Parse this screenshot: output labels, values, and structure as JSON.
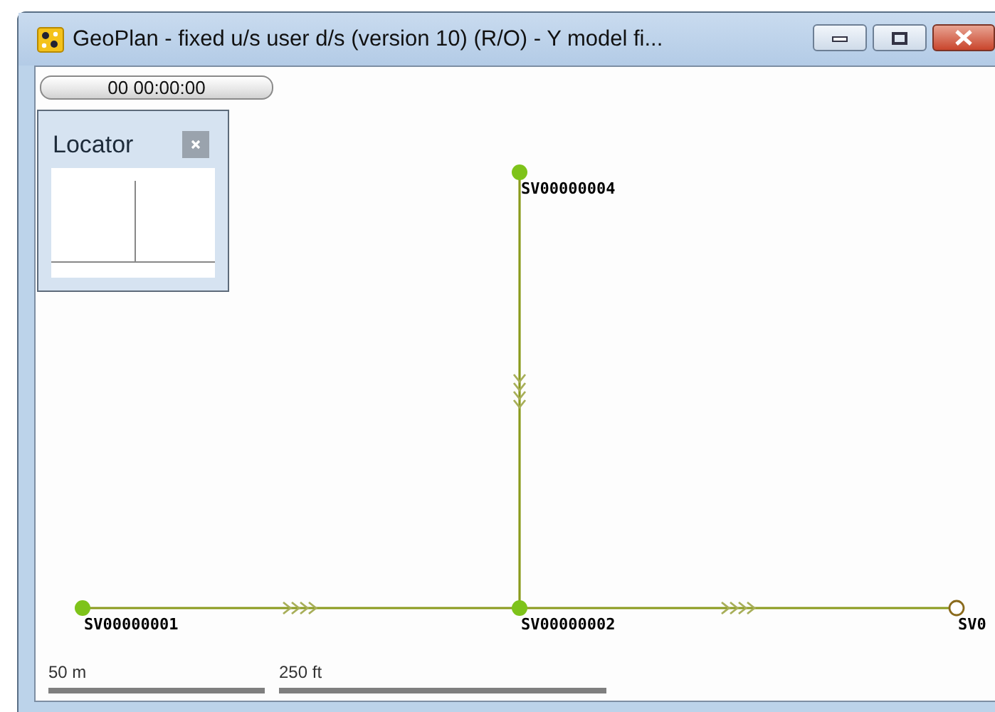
{
  "window": {
    "title": "GeoPlan - fixed u/s user d/s (version 10) (R/O) - Y model fi..."
  },
  "time_bar": {
    "text": "00 00:00:00"
  },
  "locator": {
    "title": "Locator"
  },
  "nodes": [
    {
      "label": "SV00000004",
      "filled": true
    },
    {
      "label": "SV00000001",
      "filled": true
    },
    {
      "label": "SV00000002",
      "filled": true
    },
    {
      "label": "SV0",
      "filled": false
    }
  ],
  "links": [
    {
      "flow_arrows": true
    },
    {
      "flow_arrows": true
    },
    {
      "flow_arrows": true
    }
  ],
  "scale_bars": [
    {
      "label": "50 m"
    },
    {
      "label": "250 ft"
    }
  ]
}
